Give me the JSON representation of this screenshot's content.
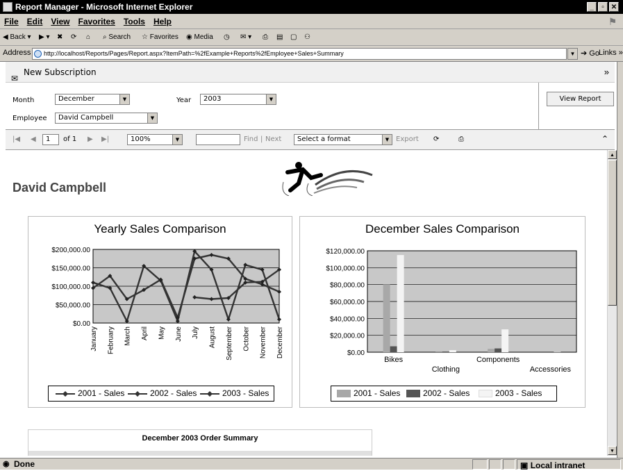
{
  "window": {
    "title": "Report Manager - Microsoft Internet Explorer",
    "buttons": [
      "_",
      "▫",
      "✕"
    ]
  },
  "menu": [
    "File",
    "Edit",
    "View",
    "Favorites",
    "Tools",
    "Help"
  ],
  "toolbar": {
    "back": "Back",
    "search": "Search",
    "favorites": "Favorites",
    "media": "Media"
  },
  "address": {
    "label": "Address",
    "url": "http://localhost/Reports/Pages/Report.aspx?ItemPath=%2fExample+Reports%2fEmployee+Sales+Summary",
    "go": "Go",
    "links": "Links »"
  },
  "subscription": {
    "label": "New Subscription"
  },
  "params": {
    "month_label": "Month",
    "month_value": "December",
    "year_label": "Year",
    "year_value": "2003",
    "employee_label": "Employee",
    "employee_value": "David Campbell",
    "view_report": "View Report"
  },
  "reportbar": {
    "page": "1",
    "of": "of 1",
    "zoom": "100%",
    "find": "Find",
    "sep": "|",
    "next": "Next",
    "format": "Select a format",
    "export": "Export"
  },
  "report": {
    "employee_name": "David Campbell",
    "summary_title": "December 2003 Order Summary"
  },
  "status": {
    "done": "Done",
    "zone": "Local intranet"
  },
  "colors": {
    "plot_bg": "#c8c8c8",
    "bar_2001": "#a8a8a8",
    "bar_2002": "#555555",
    "bar_2003": "#f4f4f4",
    "line": "#333333"
  },
  "chart_data": [
    {
      "type": "line",
      "title": "Yearly Sales Comparison",
      "categories": [
        "January",
        "February",
        "March",
        "April",
        "May",
        "June",
        "July",
        "August",
        "September",
        "October",
        "November",
        "December"
      ],
      "y_ticks": [
        "$200,000.00",
        "$150,000.00",
        "$100,000.00",
        "$50,000.00",
        "$0.00"
      ],
      "ylim": [
        0,
        200000
      ],
      "grid": true,
      "legend": "bottom",
      "series": [
        {
          "name": "2001 - Sales",
          "values": [
            null,
            null,
            null,
            null,
            null,
            null,
            70000,
            65000,
            68000,
            110000,
            112000,
            145000
          ]
        },
        {
          "name": "2002 - Sales",
          "values": [
            110000,
            95000,
            5000,
            155000,
            115000,
            5000,
            195000,
            145000,
            10000,
            158000,
            145000,
            10000
          ]
        },
        {
          "name": "2003 - Sales",
          "values": [
            95000,
            128000,
            65000,
            90000,
            118000,
            15000,
            175000,
            185000,
            175000,
            120000,
            105000,
            85000
          ]
        }
      ]
    },
    {
      "type": "bar",
      "title": "December Sales Comparison",
      "categories": [
        "Bikes",
        "Clothing",
        "Components",
        "Accessories"
      ],
      "y_ticks": [
        "$120,000.00",
        "$100,000.00",
        "$80,000.00",
        "$60,000.00",
        "$40,000.00",
        "$20,000.00",
        "$0.00"
      ],
      "ylim": [
        0,
        120000
      ],
      "grid": true,
      "legend": "bottom",
      "series": [
        {
          "name": "2001 - Sales",
          "values": [
            80000,
            200,
            4000,
            0
          ]
        },
        {
          "name": "2002 - Sales",
          "values": [
            7000,
            800,
            4500,
            0
          ]
        },
        {
          "name": "2003 - Sales",
          "values": [
            115000,
            2500,
            27000,
            300
          ]
        }
      ]
    }
  ]
}
